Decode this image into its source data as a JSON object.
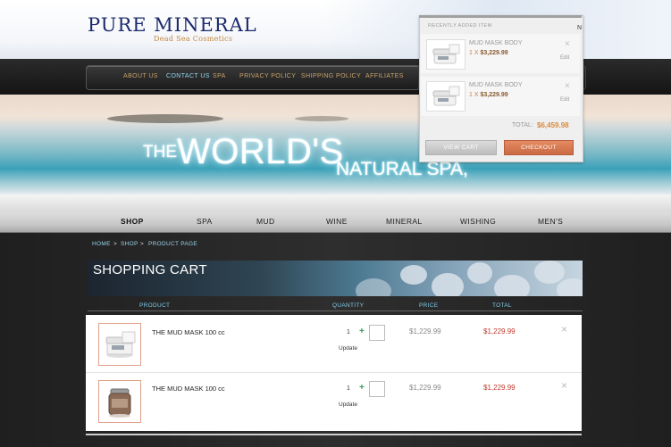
{
  "header": {
    "logo_main": "PURE MINERAL",
    "logo_sub": "Dead Sea Cosmetics"
  },
  "top_nav": [
    {
      "label": "ABOUT US"
    },
    {
      "label": "CONTACT US",
      "active": true
    },
    {
      "label": "SPA"
    },
    {
      "label": "PRIVACY POLICY"
    },
    {
      "label": "SHIPPING POLICY"
    },
    {
      "label": "AFFILIATES"
    }
  ],
  "hero": {
    "the": "THE",
    "worlds": "WORLD'S",
    "natural_spa": "NATURAL SPA,"
  },
  "category_nav": [
    {
      "label": "SHOP",
      "active": true
    },
    {
      "label": "SPA"
    },
    {
      "label": "MUD"
    },
    {
      "label": "WINE"
    },
    {
      "label": "MINERAL"
    },
    {
      "label": "WISHING"
    },
    {
      "label": "MEN'S"
    }
  ],
  "breadcrumb": [
    {
      "label": "HOME"
    },
    {
      "label": "SHOP"
    },
    {
      "label": "PRODUCT PAGE"
    }
  ],
  "breadcrumb_separator": ">",
  "page_title": "SHOPPING CART",
  "cart_table": {
    "columns": [
      "PRODUCT",
      "QUANTITY",
      "PRICE",
      "TOTAL"
    ],
    "update_label": "Update",
    "rows": [
      {
        "name": "THE MUD MASK 100 cc",
        "qty": "1",
        "price": "$1,229.99",
        "total": "$1,229.99",
        "image": "white-jar"
      },
      {
        "name": "THE MUD MASK 100 cc",
        "qty": "1",
        "price": "$1,229.99",
        "total": "$1,229.99",
        "image": "mud-jar"
      }
    ]
  },
  "mini_cart": {
    "heading": "RECENTLY ADDED ITEM",
    "items": [
      {
        "name": "MUD MASK BODY",
        "qty_prefix": "1 X",
        "price": "$3,229.99",
        "edit": "Edit"
      },
      {
        "name": "MUD MASK BODY",
        "qty_prefix": "1 X",
        "price": "$3,229.99",
        "edit": "Edit"
      }
    ],
    "total_label": "TOTAL:",
    "total_value": "$6,459.98",
    "view_cart": "VIEW CART",
    "checkout": "CHECKOUT",
    "partial_glyph": "N"
  },
  "icons": {
    "plus": "+",
    "remove": "×",
    "close": "×"
  },
  "colors": {
    "accent_orange": "#c0392b",
    "breadcrumb_blue": "#9bd4ea",
    "logo_blue": "#1c2a6b",
    "logo_gold": "#c2873e"
  }
}
